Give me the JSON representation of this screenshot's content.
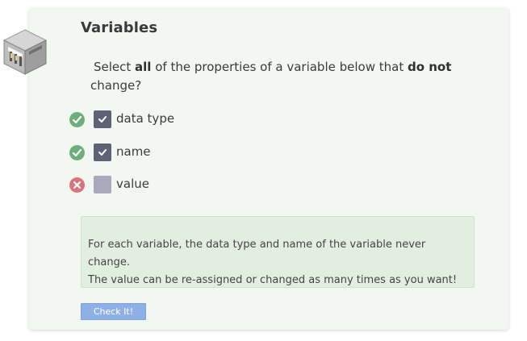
{
  "title": "Variables",
  "question": {
    "prefix": "Select ",
    "bold1": "all",
    "middle": " of the properties of a variable below that ",
    "bold2": "do not",
    "suffix": " change?"
  },
  "options": [
    {
      "label": "data type",
      "checked": true,
      "status": "correct"
    },
    {
      "label": "name",
      "checked": true,
      "status": "correct"
    },
    {
      "label": "value",
      "checked": false,
      "status": "incorrect"
    }
  ],
  "feedback": {
    "line1": "For each variable, the data type and name of the variable never change.",
    "line2": "The value can be re-assigned or changed as many times as you want!"
  },
  "check_button": {
    "label": "Check It!"
  },
  "colors": {
    "correct": "#6bb07a",
    "incorrect": "#d9757a",
    "checked_box": "#5f6275",
    "unchecked_box": "#a9a9bd",
    "button": "#8fb0e6"
  }
}
